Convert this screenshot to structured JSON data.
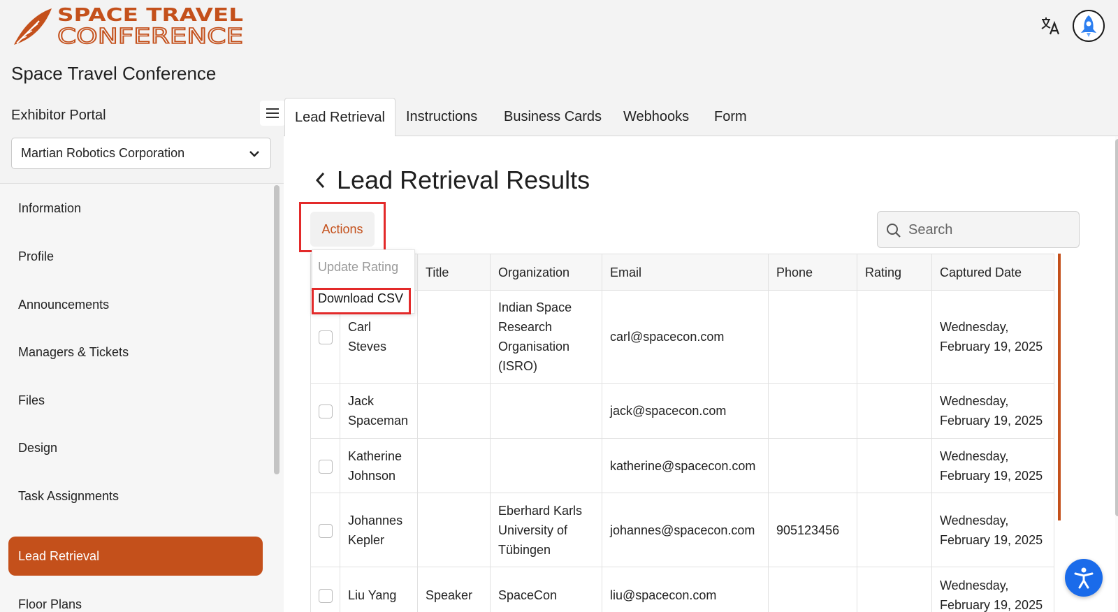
{
  "header": {
    "logo_line1": "SPACE TRAVEL",
    "logo_line2": "CONFERENCE",
    "site_title": "Space Travel Conference",
    "icons": [
      "translate-icon",
      "rocket-avatar"
    ]
  },
  "sidebar": {
    "portal_label": "Exhibitor Portal",
    "company_selected": "Martian Robotics Corporation",
    "items": [
      {
        "label": "Information"
      },
      {
        "label": "Profile"
      },
      {
        "label": "Announcements"
      },
      {
        "label": "Managers & Tickets"
      },
      {
        "label": "Files"
      },
      {
        "label": "Design"
      },
      {
        "label": "Task Assignments"
      },
      {
        "label": "Lead Retrieval",
        "active": true
      },
      {
        "label": "Floor Plans"
      }
    ]
  },
  "tabs": [
    {
      "label": "Lead Retrieval",
      "active": true
    },
    {
      "label": "Instructions"
    },
    {
      "label": "Business Cards"
    },
    {
      "label": "Webhooks"
    },
    {
      "label": "Form"
    }
  ],
  "main": {
    "title": "Lead Retrieval Results",
    "actions_label": "Actions",
    "search_placeholder": "Search",
    "actions_menu": {
      "update_rating": "Update Rating",
      "download_csv": "Download CSV"
    }
  },
  "table": {
    "columns": [
      "",
      "",
      "Title",
      "Organization",
      "Email",
      "Phone",
      "Rating",
      "Captured Date"
    ],
    "rows": [
      {
        "name": "Carl Steves",
        "title": "",
        "organization": "Indian Space Research Organisation (ISRO)",
        "email": "carl@spacecon.com",
        "phone": "",
        "rating": "",
        "captured": "Wednesday, February 19, 2025"
      },
      {
        "name": "Jack Spaceman",
        "title": "",
        "organization": "",
        "email": "jack@spacecon.com",
        "phone": "",
        "rating": "",
        "captured": "Wednesday, February 19, 2025"
      },
      {
        "name": "Katherine Johnson",
        "title": "",
        "organization": "",
        "email": "katherine@spacecon.com",
        "phone": "",
        "rating": "",
        "captured": "Wednesday, February 19, 2025"
      },
      {
        "name": "Johannes Kepler",
        "title": "",
        "organization": "Eberhard Karls University of Tübingen",
        "email": "johannes@spacecon.com",
        "phone": "905123456",
        "rating": "",
        "captured": "Wednesday, February 19, 2025"
      },
      {
        "name": "Liu Yang",
        "title": "Speaker",
        "organization": "SpaceCon",
        "email": "liu@spacecon.com",
        "phone": "",
        "rating": "",
        "captured": "Wednesday, February 19, 2025"
      }
    ]
  },
  "colors": {
    "brand": "#c4501b",
    "highlight": "#e32a2a",
    "accessibility": "#1a6bea"
  }
}
